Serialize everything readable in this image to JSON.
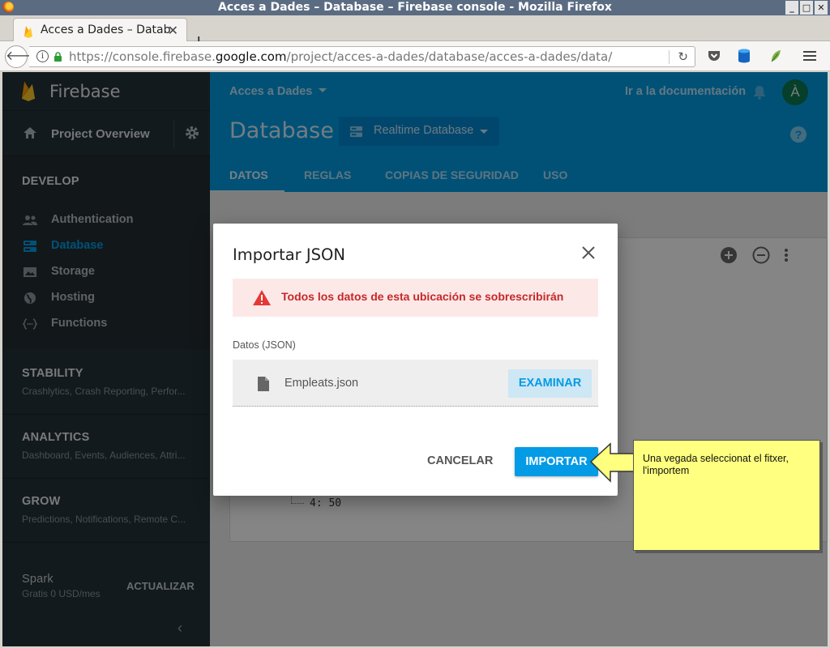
{
  "window": {
    "title": "Acces a Dades – Database – Firebase console - Mozilla Firefox"
  },
  "browser": {
    "tab_title": "Acces a Dades – Database – Firebase console",
    "url_prefix": "https://console.firebase.",
    "url_domain": "google.com",
    "url_path": "/project/acces-a-dades/database/acces-a-dades/data/"
  },
  "sidebar": {
    "brand": "Firebase",
    "overview": "Project Overview",
    "develop": {
      "title": "DEVELOP",
      "items": [
        {
          "label": "Authentication",
          "icon": "people-icon"
        },
        {
          "label": "Database",
          "icon": "database-icon",
          "active": true
        },
        {
          "label": "Storage",
          "icon": "image-icon"
        },
        {
          "label": "Hosting",
          "icon": "globe-icon"
        },
        {
          "label": "Functions",
          "icon": "functions-icon"
        }
      ]
    },
    "stability": {
      "title": "STABILITY",
      "subtitle": "Crashlytics, Crash Reporting, Perfor..."
    },
    "analytics": {
      "title": "ANALYTICS",
      "subtitle": "Dashboard, Events, Audiences, Attri..."
    },
    "grow": {
      "title": "GROW",
      "subtitle": "Predictions, Notifications, Remote C..."
    },
    "plan": {
      "name": "Spark",
      "price": "Gratis 0 USD/mes",
      "upgrade": "ACTUALIZAR"
    }
  },
  "header": {
    "project": "Acces a Dades",
    "docs": "Ir a la documentación",
    "avatar_letter": "À",
    "title": "Database",
    "db_selector": "Realtime Database",
    "tabs": [
      "DATOS",
      "REGLAS",
      "COPIAS DE SEGURIDAD",
      "USO"
    ]
  },
  "tree": {
    "last_node": "4: 50"
  },
  "modal": {
    "title": "Importar JSON",
    "warning": "Todos los datos de esta ubicación se sobrescribirán",
    "field_label": "Datos (JSON)",
    "file_name": "Empleats.json",
    "browse": "EXAMINAR",
    "cancel": "CANCELAR",
    "import": "IMPORTAR"
  },
  "callout": {
    "text": "Una vegada seleccionat el fitxer, l'importem"
  },
  "colors": {
    "accent": "#039be5",
    "sidebar": "#263238",
    "warning": "#c62828",
    "callout": "#ffff80"
  }
}
